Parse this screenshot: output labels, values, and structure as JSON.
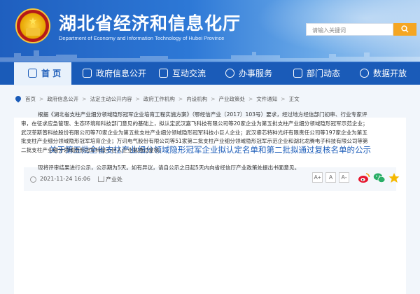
{
  "header": {
    "site_title": "湖北省经济和信息化厅",
    "site_subtitle": "Department of Economy and Information Technology of Hubei Province",
    "search_placeholder": "请输入关键词"
  },
  "nav": {
    "items": [
      {
        "label": "首 页",
        "icon": "home-icon"
      },
      {
        "label": "政府信息公开",
        "icon": "info-disclosure-icon"
      },
      {
        "label": "互动交流",
        "icon": "chat-icon"
      },
      {
        "label": "办事服务",
        "icon": "service-icon"
      },
      {
        "label": "部门动态",
        "icon": "news-icon"
      },
      {
        "label": "数据开放",
        "icon": "data-icon"
      }
    ],
    "active_index": 0
  },
  "breadcrumb": [
    "首页",
    "政府信息公开",
    "法定主动公开内容",
    "政府工作机构",
    "内设机构",
    "产业政策处",
    "文件通知",
    "正文"
  ],
  "article": {
    "title": "关于第五批全省支柱产业细分领域隐形冠军企业拟认定名单和第二批拟通过复核名单的公示",
    "date": "2021-11-24 16:06",
    "source": "产业处",
    "font_buttons": [
      "A+",
      "A",
      "A-"
    ],
    "share_icons": [
      "weibo-icon",
      "wechat-icon",
      "favorite-icon"
    ],
    "paragraphs": [
      "根据《湖北省支柱产业细分领域隐形冠军企业培育工程实施方案》（鄂经信产业〔2017〕103号）要求，经过地方经信部门初审、行业专家评审，在征求应急管理、生态环境和科技部门意见的基础上，拟认定武汉嘉飞科技有限公司等20家企业为第五批支柱产业细分领域隐形冠军示范企业；武汉菲斯普科技股份有限公司等70家企业为第五批支柱产业细分领域隐形冠军科技小巨人企业；武汉睿芯特种光纤有限责任公司等197家企业为第五批支柱产业细分领域隐形冠军培育企业；万讯电气股份有限公司等51家第二批支柱产业细分领域隐形冠军示范企业和湖北龙腾电子科技有限公司等第二批支柱产业细分领域隐形冠军科技小巨人企业拟通过复核。",
      "现将评审结果进行公示，公示期为5天。如有异议，请自公示之日起5天内向省经信厅产业政策处提出书面意见。"
    ]
  },
  "colors": {
    "brand_blue": "#1a5bb8",
    "accent_orange": "#f5a623",
    "title_blue": "#1a5bb8"
  }
}
